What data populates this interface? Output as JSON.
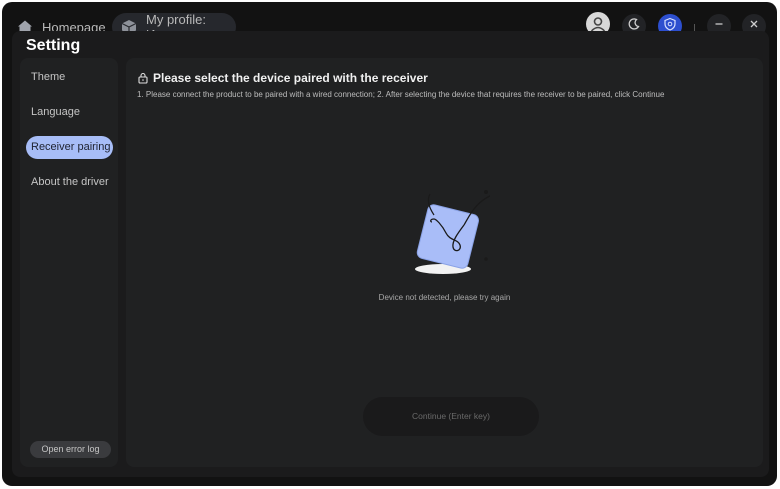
{
  "tabs": [
    {
      "label": "Homepage",
      "icon": "home-icon"
    },
    {
      "label": "My profile: Игры",
      "icon": "cube-icon"
    }
  ],
  "window_controls": [
    "user-icon",
    "moon-icon",
    "shield-icon",
    "minimize-icon",
    "close-icon"
  ],
  "settings": {
    "title": "Setting",
    "menu": [
      {
        "label": "Theme",
        "active": false
      },
      {
        "label": "Language",
        "active": false
      },
      {
        "label": "Receiver pairing",
        "active": true
      },
      {
        "label": "About the driver",
        "active": false
      }
    ],
    "error_log_label": "Open error log"
  },
  "pairing": {
    "heading": "Please select the device paired with the receiver",
    "instructions": "1. Please connect the product to be paired with a wired connection; 2. After selecting the device that requires the receiver to be paired, click Continue",
    "status": "Device not detected, please try again",
    "continue_label": "Continue (Enter key)"
  },
  "colors": {
    "accent": "#a7bdf7",
    "window_bg": "#121212",
    "panel_bg": "#202122",
    "shield_blue": "#2d4fcf"
  }
}
